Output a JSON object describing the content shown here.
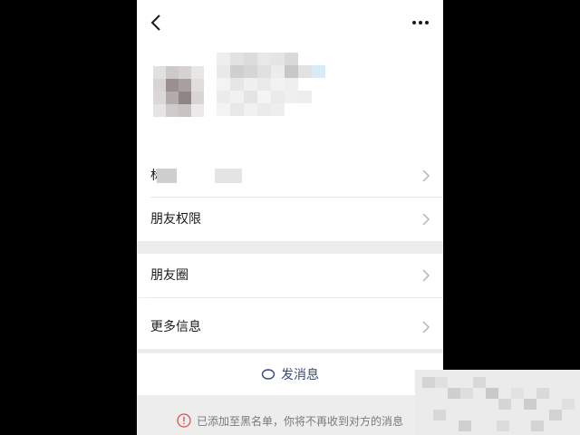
{
  "header": {
    "back_icon": "chevron-left-icon",
    "more_icon": "ellipsis-icon"
  },
  "rows": {
    "remark": {
      "label": "标"
    },
    "friend_permissions": {
      "label": "朋友权限"
    },
    "moments": {
      "label": "朋友圈"
    },
    "more_info": {
      "label": "更多信息"
    }
  },
  "send_message": {
    "label": "发消息",
    "icon": "chat-bubble-icon"
  },
  "notice": {
    "icon": "exclamation-circle-icon",
    "text": "已添加至黑名单，你将不再收到对方的消息",
    "color": "#d9534f"
  },
  "colors": {
    "link": "#3a4a7a",
    "background": "#ededed"
  }
}
